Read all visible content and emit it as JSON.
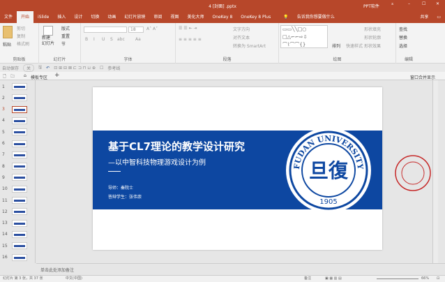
{
  "window": {
    "title": "4 [封面] .pptx",
    "app_label": "PPT软件",
    "share": "共享"
  },
  "tabs": [
    "文件",
    "开始",
    "iSlide",
    "插入",
    "设计",
    "切换",
    "动画",
    "幻灯片放映",
    "审阅",
    "视图",
    "美化大师",
    "OneKey 8",
    "OneKey 8 Plus",
    "告诉我你想要做什么"
  ],
  "active_tab": 1,
  "ribbon": {
    "clipboard": {
      "label": "剪贴板",
      "paste": "粘贴",
      "cut": "剪切",
      "copy": "复制",
      "format_painter": "格式刷"
    },
    "slides": {
      "label": "幻灯片",
      "new_slide": "新建\n幻灯片",
      "layout": "版式",
      "reset": "重置",
      "section": "节"
    },
    "font": {
      "label": "字体",
      "size": "18",
      "bold": "B",
      "italic": "I",
      "underline": "U",
      "shadow": "S",
      "strike": "abc",
      "case": "Aa"
    },
    "paragraph": {
      "label": "段落",
      "text_direction": "文字方向",
      "align_text": "对齐文本",
      "smartart": "转换为 SmartArt"
    },
    "drawing": {
      "label": "绘图",
      "arrange": "排列",
      "quick_styles": "快速样式",
      "fill": "形状填充",
      "outline": "形状轮廓",
      "effects": "形状效果"
    },
    "editing": {
      "label": "编辑",
      "find": "查找",
      "replace": "替换",
      "select": "选择"
    }
  },
  "qat": {
    "autosave": "自动保存",
    "autosave_state": "关",
    "guides": "参考线"
  },
  "doctabs": {
    "template_zone": "模板专区",
    "merge_windows": "窗口合并显示"
  },
  "thumbnails": [
    "1",
    "2",
    "3",
    "4",
    "5",
    "6",
    "7",
    "8",
    "9",
    "10",
    "11",
    "12",
    "13",
    "14",
    "15",
    "16"
  ],
  "selected_slide": 3,
  "slide": {
    "title": "基于CL7理论的教学设计研究",
    "subtitle": "—以中智科技物理游戏设计为例",
    "advisor": "导师：秦院士",
    "student": "答辩学生：张伟崇",
    "logo_text": "FUDAN UNIVERSITY",
    "logo_year": "1905",
    "logo_center": "旦復",
    "band_color": "#0d47a1",
    "seal_color": "#c62828"
  },
  "notes_placeholder": "单击此处添加备注",
  "status": {
    "slide_info": "幻灯片 第 3 张，共 37 张",
    "language": "中文(中国)",
    "notes": "备注",
    "zoom": "66%"
  }
}
